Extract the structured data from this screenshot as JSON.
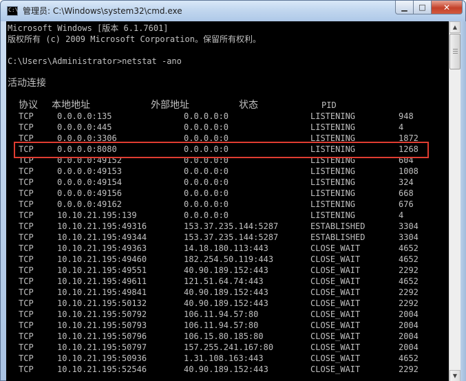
{
  "window": {
    "title": "管理员: C:\\Windows\\system32\\cmd.exe",
    "icon_text": "C:\\",
    "minimize_glyph": "▁",
    "maximize_glyph": "□",
    "close_glyph": "✕"
  },
  "console": {
    "line1": "Microsoft Windows [版本 6.1.7601]",
    "line2": "版权所有 (c) 2009 Microsoft Corporation。保留所有权利。",
    "prompt": "C:\\Users\\Administrator>netstat -ano",
    "section_title": "活动连接",
    "headers": {
      "proto": "协议",
      "local": "本地地址",
      "foreign": "外部地址",
      "state": "状态",
      "pid": "PID"
    },
    "rows": [
      {
        "proto": "TCP",
        "local": "0.0.0.0:135",
        "foreign": "0.0.0.0:0",
        "state": "LISTENING",
        "pid": "948"
      },
      {
        "proto": "TCP",
        "local": "0.0.0.0:445",
        "foreign": "0.0.0.0:0",
        "state": "LISTENING",
        "pid": "4"
      },
      {
        "proto": "TCP",
        "local": "0.0.0.0:3306",
        "foreign": "0.0.0.0:0",
        "state": "LISTENING",
        "pid": "1872"
      },
      {
        "proto": "TCP",
        "local": "0.0.0.0:8080",
        "foreign": "0.0.0.0:0",
        "state": "LISTENING",
        "pid": "1268"
      },
      {
        "proto": "TCP",
        "local": "0.0.0.0:49152",
        "foreign": "0.0.0.0:0",
        "state": "LISTENING",
        "pid": "604"
      },
      {
        "proto": "TCP",
        "local": "0.0.0.0:49153",
        "foreign": "0.0.0.0:0",
        "state": "LISTENING",
        "pid": "1008"
      },
      {
        "proto": "TCP",
        "local": "0.0.0.0:49154",
        "foreign": "0.0.0.0:0",
        "state": "LISTENING",
        "pid": "324"
      },
      {
        "proto": "TCP",
        "local": "0.0.0.0:49156",
        "foreign": "0.0.0.0:0",
        "state": "LISTENING",
        "pid": "668"
      },
      {
        "proto": "TCP",
        "local": "0.0.0.0:49162",
        "foreign": "0.0.0.0:0",
        "state": "LISTENING",
        "pid": "676"
      },
      {
        "proto": "TCP",
        "local": "10.10.21.195:139",
        "foreign": "0.0.0.0:0",
        "state": "LISTENING",
        "pid": "4"
      },
      {
        "proto": "TCP",
        "local": "10.10.21.195:49316",
        "foreign": "153.37.235.144:5287",
        "state": "ESTABLISHED",
        "pid": "3304"
      },
      {
        "proto": "TCP",
        "local": "10.10.21.195:49344",
        "foreign": "153.37.235.144:5287",
        "state": "ESTABLISHED",
        "pid": "3304"
      },
      {
        "proto": "TCP",
        "local": "10.10.21.195:49363",
        "foreign": "14.18.180.113:443",
        "state": "CLOSE_WAIT",
        "pid": "4652"
      },
      {
        "proto": "TCP",
        "local": "10.10.21.195:49460",
        "foreign": "182.254.50.119:443",
        "state": "CLOSE_WAIT",
        "pid": "4652"
      },
      {
        "proto": "TCP",
        "local": "10.10.21.195:49551",
        "foreign": "40.90.189.152:443",
        "state": "CLOSE_WAIT",
        "pid": "2292"
      },
      {
        "proto": "TCP",
        "local": "10.10.21.195:49611",
        "foreign": "121.51.64.74:443",
        "state": "CLOSE_WAIT",
        "pid": "4652"
      },
      {
        "proto": "TCP",
        "local": "10.10.21.195:49841",
        "foreign": "40.90.189.152:443",
        "state": "CLOSE_WAIT",
        "pid": "2292"
      },
      {
        "proto": "TCP",
        "local": "10.10.21.195:50132",
        "foreign": "40.90.189.152:443",
        "state": "CLOSE_WAIT",
        "pid": "2292"
      },
      {
        "proto": "TCP",
        "local": "10.10.21.195:50792",
        "foreign": "106.11.94.57:80",
        "state": "CLOSE_WAIT",
        "pid": "2004"
      },
      {
        "proto": "TCP",
        "local": "10.10.21.195:50793",
        "foreign": "106.11.94.57:80",
        "state": "CLOSE_WAIT",
        "pid": "2004"
      },
      {
        "proto": "TCP",
        "local": "10.10.21.195:50796",
        "foreign": "106.15.80.185:80",
        "state": "CLOSE_WAIT",
        "pid": "2004"
      },
      {
        "proto": "TCP",
        "local": "10.10.21.195:50797",
        "foreign": "157.255.241.167:80",
        "state": "CLOSE_WAIT",
        "pid": "2004"
      },
      {
        "proto": "TCP",
        "local": "10.10.21.195:50936",
        "foreign": "1.31.108.163:443",
        "state": "CLOSE_WAIT",
        "pid": "4652"
      },
      {
        "proto": "TCP",
        "local": "10.10.21.195:52546",
        "foreign": "40.90.189.152:443",
        "state": "CLOSE_WAIT",
        "pid": "2292"
      }
    ],
    "highlighted_row": 3
  },
  "colors": {
    "console_bg": "#000000",
    "console_text": "#c0c0c0",
    "highlight_border": "#e03c31"
  },
  "scrollbar": {
    "up_glyph": "▲",
    "down_glyph": "▼"
  }
}
